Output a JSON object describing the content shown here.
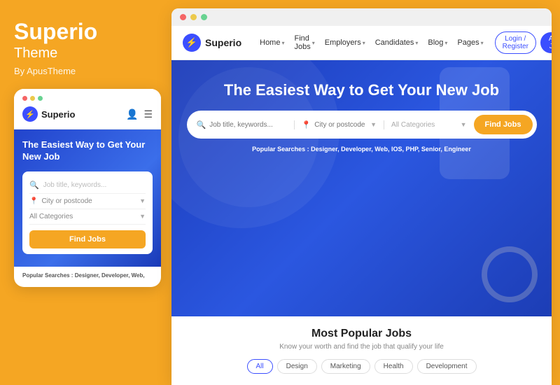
{
  "left": {
    "title": "Superio",
    "subtitle": "Theme",
    "by": "By ApusTheme"
  },
  "mobile": {
    "dots": [
      "#F56565",
      "#ECC94B",
      "#68D391"
    ],
    "logo_text": "Superio",
    "hero_title": "The Easiest Way to Get Your New Job",
    "search_placeholder": "Job title, keywords...",
    "location_placeholder": "City or postcode",
    "category_placeholder": "All Categories",
    "find_btn": "Find Jobs",
    "popular_label": "Popular Searches :",
    "popular_items": "Designer, Developer, Web,"
  },
  "browser": {
    "dots": [
      "#F56565",
      "#ECC94B",
      "#68D391"
    ]
  },
  "site_nav": {
    "logo_text": "Superio",
    "links": [
      {
        "label": "Home",
        "has_caret": true
      },
      {
        "label": "Find Jobs",
        "has_caret": true
      },
      {
        "label": "Employers",
        "has_caret": true
      },
      {
        "label": "Candidates",
        "has_caret": true
      },
      {
        "label": "Blog",
        "has_caret": true
      },
      {
        "label": "Pages",
        "has_caret": true
      }
    ],
    "login_btn": "Login / Register",
    "add_job_btn": "Add Job"
  },
  "hero": {
    "title": "The Easiest Way to Get Your New Job",
    "search_placeholder": "Job title, keywords...",
    "location_placeholder": "City or postcode",
    "category_placeholder": "All Categories",
    "find_btn": "Find Jobs",
    "popular_label": "Popular Searches :",
    "popular_items": "Designer, Developer, Web, IOS, PHP, Senior, Engineer"
  },
  "below_hero": {
    "title": "Most Popular Jobs",
    "subtitle": "Know your worth and find the job that qualify your life",
    "tags": [
      {
        "label": "All",
        "active": true
      },
      {
        "label": "Design"
      },
      {
        "label": "Marketing"
      },
      {
        "label": "Health"
      },
      {
        "label": "Development"
      }
    ]
  }
}
